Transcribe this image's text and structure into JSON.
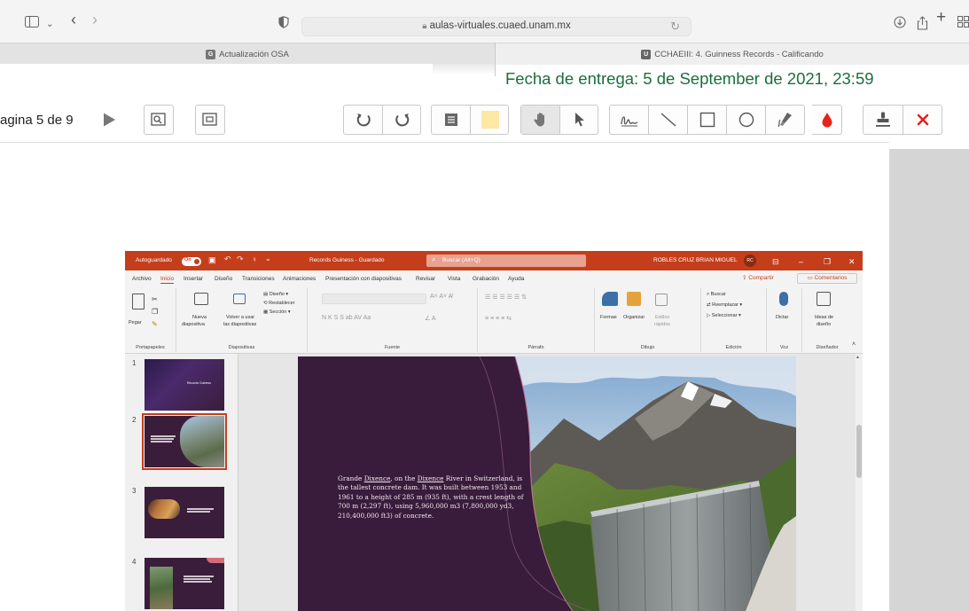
{
  "browser": {
    "url": "aulas-virtuales.cuaed.unam.mx",
    "tabs": [
      {
        "favicon": "G",
        "title": "Actualización OSA"
      },
      {
        "favicon": "U",
        "title": "CCHAEIII: 4. Guinness Records - Calificando"
      }
    ]
  },
  "assignment": {
    "due_date": "Fecha de entrega: 5 de September de 2021, 23:59"
  },
  "pdf_toolbar": {
    "page_indicator": "agina 5 de 9"
  },
  "ppt": {
    "autosave": "Autoguardado",
    "autosave_state": "On",
    "doc_title": "Records Guiness - Guardado",
    "search_placeholder": "Buscar (Alt+Q)",
    "user_name": "ROBLES CRUZ BRIAN MIGUEL",
    "user_initials": "RC",
    "menu": [
      "Archivo",
      "Inicio",
      "Insertar",
      "Diseño",
      "Transiciones",
      "Animaciones",
      "Presentación con diapositivas",
      "Revisar",
      "Vista",
      "Grabación",
      "Ayuda"
    ],
    "share": "Compartir",
    "comments": "Comentarios",
    "ribbon": {
      "pegar": "Pegar",
      "nueva_1": "Nueva",
      "nueva_2": "diapositiva",
      "volver_1": "Volver a usar",
      "volver_2": "las diapositivas",
      "diseno": "Diseño",
      "restablecer": "Restablecer",
      "seccion": "Sección",
      "formas": "Formas",
      "organizar": "Organizar",
      "estilos_1": "Estilos",
      "estilos_2": "rápidos",
      "buscar": "Buscar",
      "reemplazar": "Reemplazar",
      "seleccionar": "Seleccionar",
      "dictar": "Dictar",
      "ideas_1": "Ideas de",
      "ideas_2": "diseño",
      "groups": [
        "Portapapeles",
        "Diapositivas",
        "Fuente",
        "Párrafo",
        "Dibujo",
        "Edición",
        "Voz",
        "Diseñador"
      ]
    },
    "thumbnails": [
      {
        "num": "1",
        "title": "Records Guiness"
      },
      {
        "num": "2"
      },
      {
        "num": "3"
      },
      {
        "num": "4"
      }
    ],
    "slide": {
      "text_pre": "Grande ",
      "text_link1": "Dixence",
      "text_mid": ", on the ",
      "text_link2": "Dixence",
      "text_post": " River in Switzerland, is the tallest concrete dam. It was built between 1953 and 1961 to a height of 285 m (935 ft), with a crest length of 700 m (2,297 ft), using 5,960,000 m3 (7,800,000 yd3, 210,400,000 ft3) of concrete."
    }
  },
  "colors": {
    "ppt_accent": "#c43e1c",
    "slide_bg": "#391b3b",
    "due_date": "#1b6e3c"
  }
}
